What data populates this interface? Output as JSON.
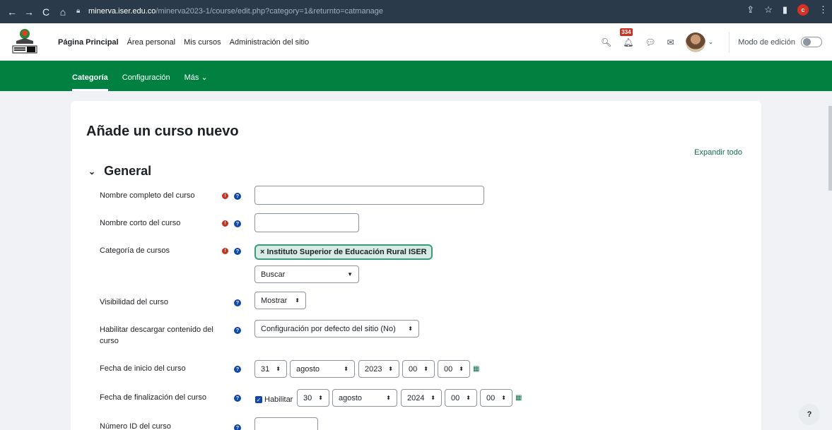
{
  "browser": {
    "back": "←",
    "forward": "→",
    "reload": "C",
    "home": "⌂",
    "url_host": "minerva.iser.edu.co",
    "url_path": "/minerva2023-1/course/edit.php?category=1&returnto=catmanage",
    "profile_letter": "c"
  },
  "topnav": {
    "items": [
      "Página Principal",
      "Área personal",
      "Mis cursos",
      "Administración del sitio"
    ],
    "notification_count": "334",
    "edit_mode_label": "Modo de edición"
  },
  "secnav": {
    "tabs": [
      "Categoría",
      "Configuración",
      "Más ⌄"
    ]
  },
  "page": {
    "title": "Añade un curso nuevo",
    "expand_all": "Expandir todo",
    "section_title": "General"
  },
  "form": {
    "fullname_label": "Nombre completo del curso",
    "shortname_label": "Nombre corto del curso",
    "category_label": "Categoría de cursos",
    "category_tag": "× Instituto Superior de Educación Rural ISER",
    "category_search": "Buscar",
    "visibility_label": "Visibilidad del curso",
    "visibility_value": "Mostrar",
    "download_label": "Habilitar descargar contenido del curso",
    "download_value": "Configuración por defecto del sitio (No)",
    "start_label": "Fecha de inicio del curso",
    "start": {
      "day": "31",
      "month": "agosto",
      "year": "2023",
      "hour": "00",
      "minute": "00"
    },
    "end_label": "Fecha de finalización del curso",
    "end_enable": "Habilitar",
    "end": {
      "day": "30",
      "month": "agosto",
      "year": "2024",
      "hour": "00",
      "minute": "00"
    },
    "idnumber_label": "Número ID del curso"
  },
  "help_fab": "?",
  "colors": {
    "brand_green": "#008140",
    "required_red": "#ca3120",
    "help_blue": "#0f47ad",
    "browser_bar": "#2b3a4a"
  }
}
